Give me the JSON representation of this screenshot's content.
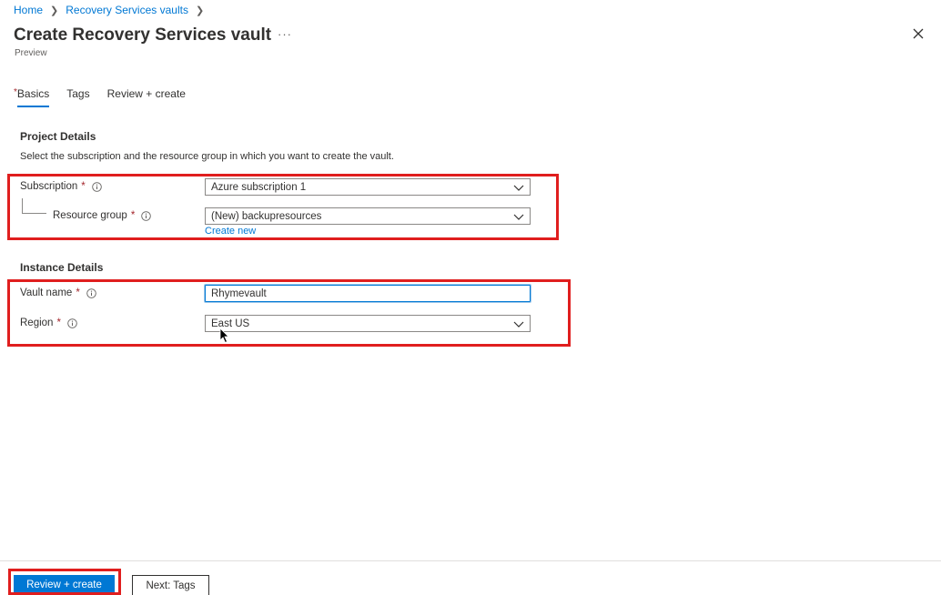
{
  "breadcrumb": {
    "home": "Home",
    "vaults": "Recovery Services vaults"
  },
  "header": {
    "title": "Create Recovery Services vault",
    "more": "···",
    "subtitle": "Preview"
  },
  "tabs": [
    {
      "label": "Basics",
      "required": "*",
      "active": true
    },
    {
      "label": "Tags"
    },
    {
      "label": "Review + create"
    }
  ],
  "project": {
    "heading": "Project Details",
    "description": "Select the subscription and the resource group in which you want to create the vault.",
    "subscription": {
      "label": "Subscription",
      "star": "*",
      "value": "Azure subscription 1"
    },
    "resource_group": {
      "label": "Resource group",
      "star": "*",
      "value": "(New) backupresources",
      "create_new": "Create new"
    }
  },
  "instance": {
    "heading": "Instance Details",
    "vault_name": {
      "label": "Vault name",
      "star": "*",
      "value": "Rhymevault"
    },
    "region": {
      "label": "Region",
      "star": "*",
      "value": "East US"
    }
  },
  "footer": {
    "primary": "Review + create",
    "secondary": "Next: Tags"
  },
  "colors": {
    "accent": "#0078d4",
    "highlight": "#e01e1e",
    "required": "#a4262c"
  }
}
